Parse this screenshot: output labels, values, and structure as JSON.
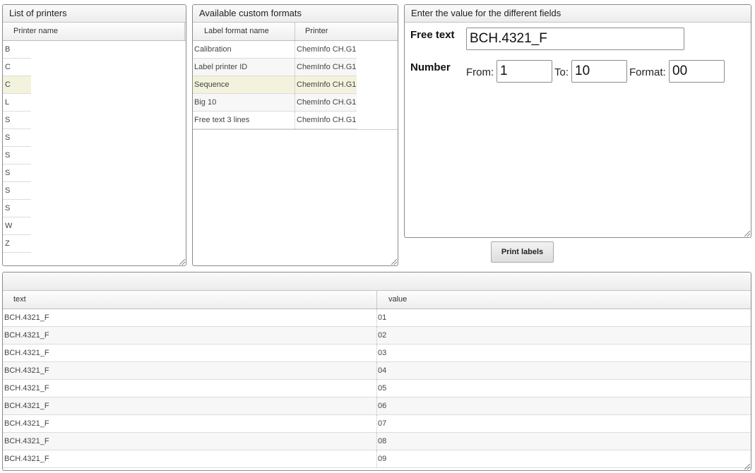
{
  "printers": {
    "title": "List of printers",
    "column_header": "Printer name",
    "items": [
      "B",
      "C",
      "C",
      "L",
      "S",
      "S",
      "S",
      "S",
      "S",
      "S",
      "W",
      "Z"
    ],
    "selected_index": 2
  },
  "formats": {
    "title": "Available custom formats",
    "columns": [
      "Label format name",
      "Printer"
    ],
    "rows": [
      {
        "name": "Calibration",
        "printer": "ChemInfo CH.G1."
      },
      {
        "name": "Label printer ID",
        "printer": "ChemInfo CH.G1."
      },
      {
        "name": "Sequence",
        "printer": "ChemInfo CH.G1."
      },
      {
        "name": "Big 10",
        "printer": "ChemInfo CH.G1."
      },
      {
        "name": "Free text 3 lines",
        "printer": "ChemInfo CH.G1."
      }
    ],
    "selected_index": 2
  },
  "fields": {
    "title": "Enter the value for the different fields",
    "free_text_label": "Free text",
    "free_text_value": "BCH.4321_F",
    "number_label": "Number",
    "from_label": "From:",
    "from_value": "1",
    "to_label": "To:",
    "to_value": "10",
    "format_label": "Format:",
    "format_value": "00"
  },
  "print_button_label": "Print labels",
  "results": {
    "title": "",
    "columns": [
      "text",
      "value"
    ],
    "rows": [
      {
        "text": "BCH.4321_F",
        "value": "01"
      },
      {
        "text": "BCH.4321_F",
        "value": "02"
      },
      {
        "text": "BCH.4321_F",
        "value": "03"
      },
      {
        "text": "BCH.4321_F",
        "value": "04"
      },
      {
        "text": "BCH.4321_F",
        "value": "05"
      },
      {
        "text": "BCH.4321_F",
        "value": "06"
      },
      {
        "text": "BCH.4321_F",
        "value": "07"
      },
      {
        "text": "BCH.4321_F",
        "value": "08"
      },
      {
        "text": "BCH.4321_F",
        "value": "09"
      }
    ]
  }
}
